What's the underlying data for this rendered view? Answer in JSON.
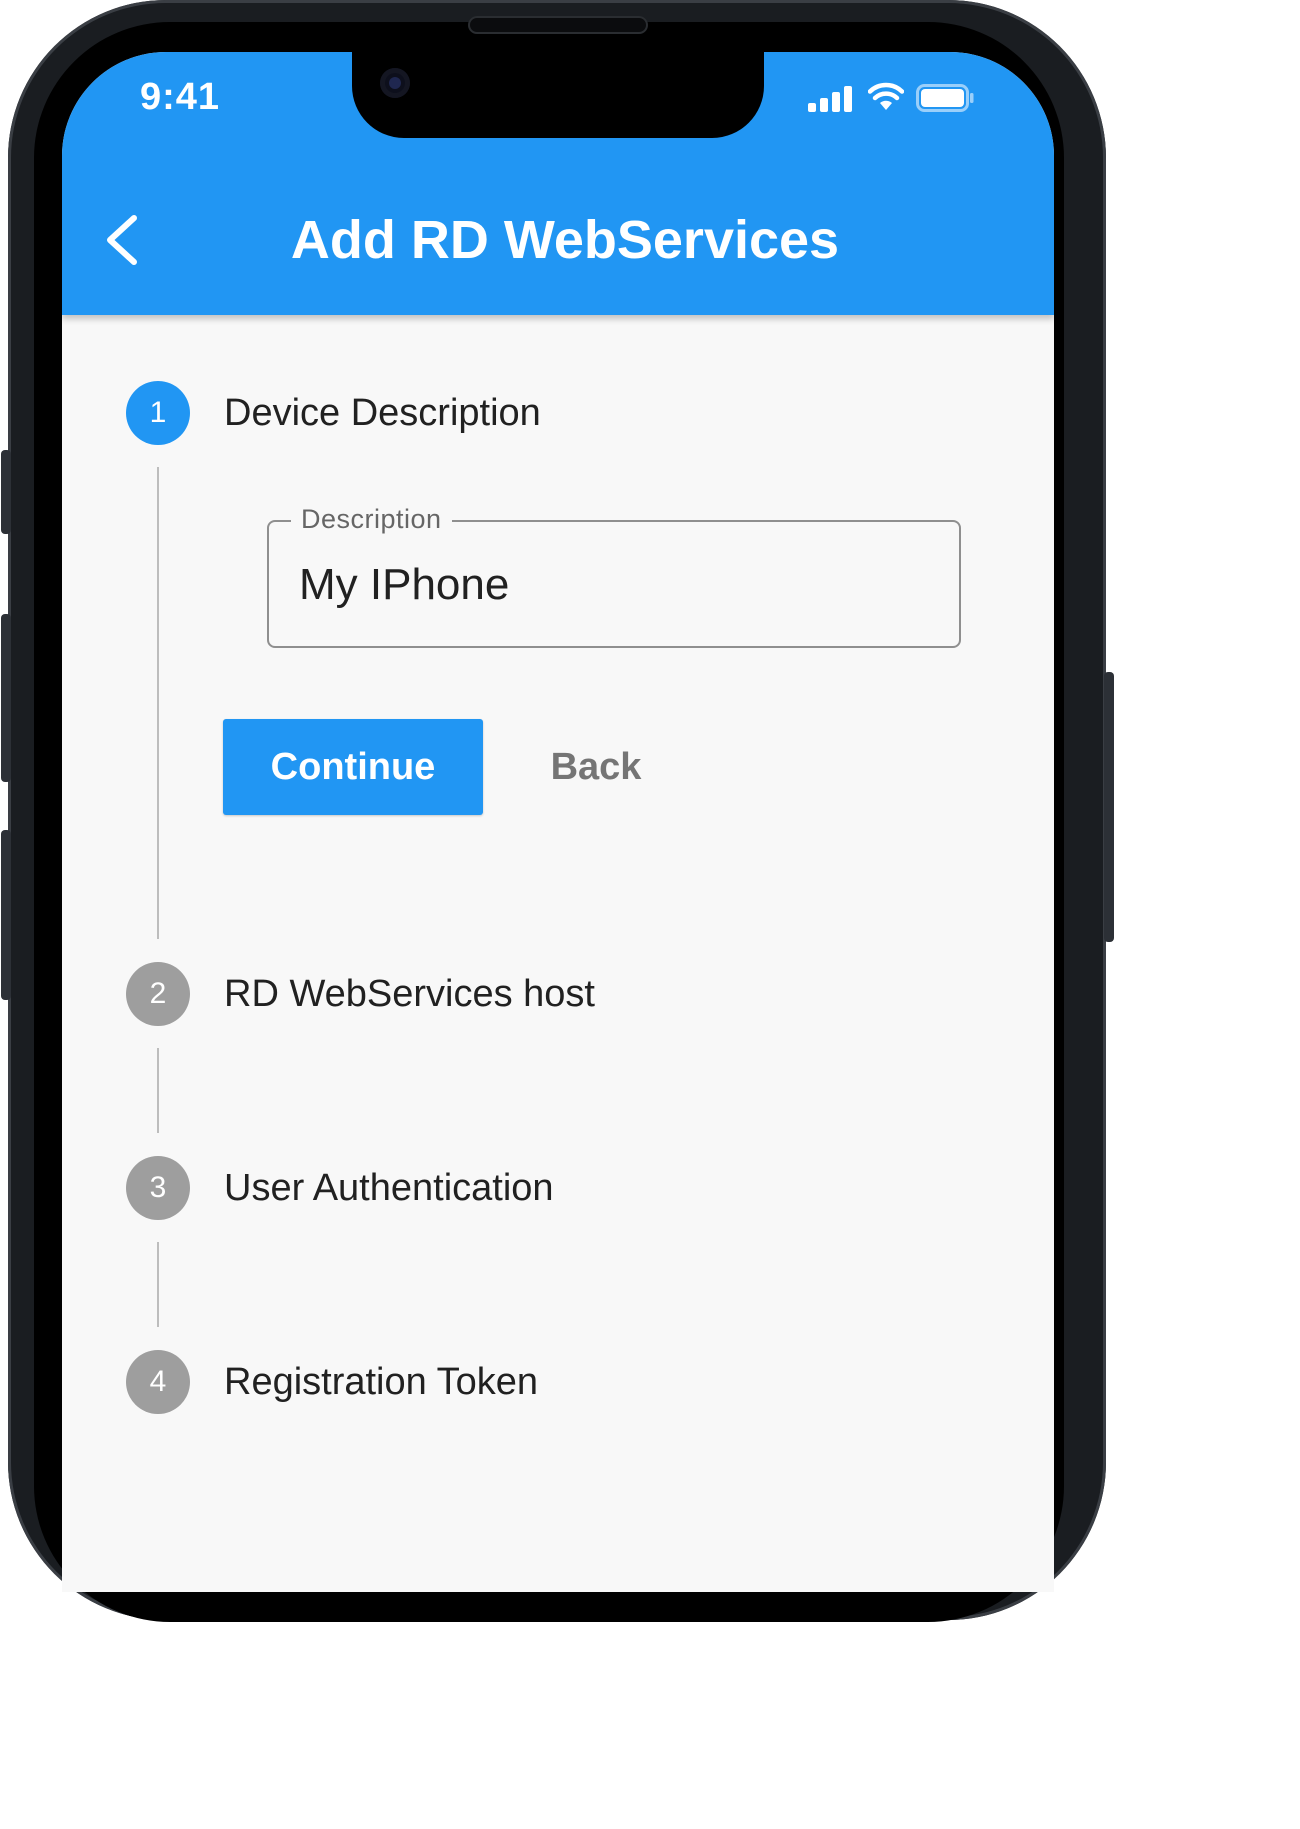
{
  "status_bar": {
    "time": "9:41",
    "icons": [
      "cellular-signal-icon",
      "wifi-icon",
      "battery-icon"
    ]
  },
  "app_bar": {
    "title": "Add RD WebServices",
    "back_icon": "chevron-left-icon",
    "color": "#2196f3"
  },
  "stepper": {
    "steps": [
      {
        "number": "1",
        "title": "Device Description",
        "state": "active"
      },
      {
        "number": "2",
        "title": "RD WebServices host",
        "state": "inactive"
      },
      {
        "number": "3",
        "title": "User Authentication",
        "state": "inactive"
      },
      {
        "number": "4",
        "title": "Registration Token",
        "state": "inactive"
      }
    ],
    "active_content": {
      "field_label": "Description",
      "field_value": "My IPhone",
      "continue_label": "Continue",
      "back_label": "Back"
    },
    "colors": {
      "active": "#2196f3",
      "inactive": "#9e9e9e"
    }
  }
}
